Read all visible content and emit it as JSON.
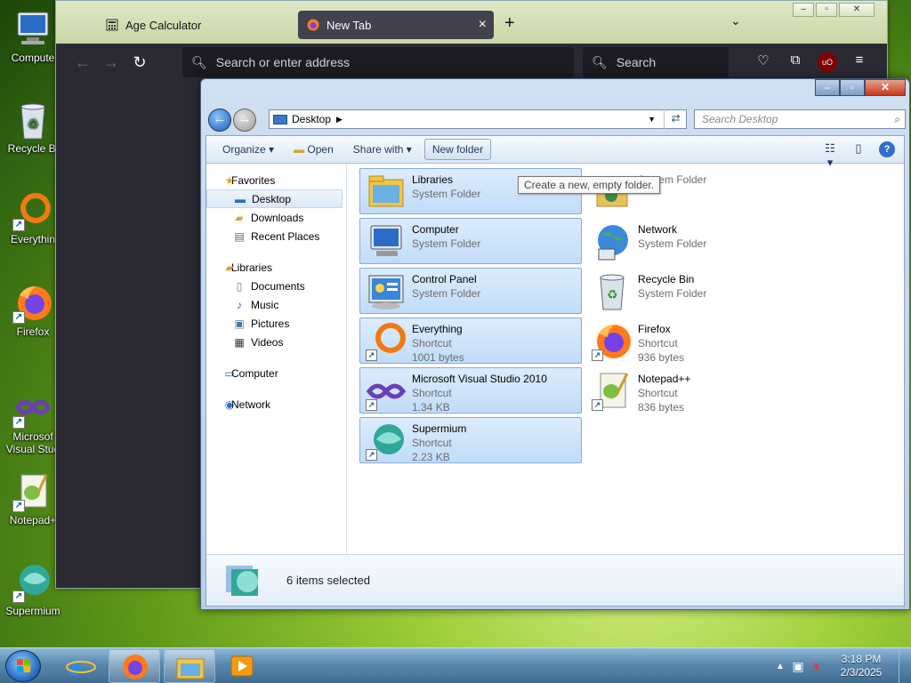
{
  "desktop": {
    "icons": [
      {
        "label": "Compute",
        "icon": "computer-icon"
      },
      {
        "label": "Recycle Bi",
        "icon": "recycle-bin-icon"
      },
      {
        "label": "Everythin",
        "icon": "everything-icon"
      },
      {
        "label": "Firefox",
        "icon": "firefox-icon"
      },
      {
        "label": "Microsof Visual Stud",
        "icon": "visual-studio-icon"
      },
      {
        "label": "Notepad+",
        "icon": "notepad-plus-plus-icon"
      },
      {
        "label": "Supermium",
        "icon": "supermium-icon"
      }
    ]
  },
  "firefox": {
    "tabs": [
      {
        "label": "Age Calculator",
        "icon": "calculator-icon"
      },
      {
        "label": "New Tab",
        "icon": "firefox-icon"
      }
    ],
    "address_placeholder": "Search or enter address",
    "search_placeholder": "Search",
    "ublock_label": "uO"
  },
  "explorer": {
    "address": "Desktop",
    "search_placeholder": "Search Desktop",
    "commands": {
      "organize": "Organize",
      "open": "Open",
      "share_with": "Share with",
      "new_folder": "New folder"
    },
    "tooltip": "Create a new, empty folder.",
    "nav": {
      "favorites": "Favorites",
      "desktop": "Desktop",
      "downloads": "Downloads",
      "recent_places": "Recent Places",
      "libraries": "Libraries",
      "documents": "Documents",
      "music": "Music",
      "pictures": "Pictures",
      "videos": "Videos",
      "computer": "Computer",
      "network": "Network"
    },
    "items": [
      {
        "name": "Libraries",
        "type": "System Folder",
        "size": "",
        "selected": true
      },
      {
        "name": "",
        "type": "System Folder",
        "size": "",
        "selected": false
      },
      {
        "name": "Computer",
        "type": "System Folder",
        "size": "",
        "selected": true
      },
      {
        "name": "Network",
        "type": "System Folder",
        "size": "",
        "selected": false
      },
      {
        "name": "Control Panel",
        "type": "System Folder",
        "size": "",
        "selected": true
      },
      {
        "name": "Recycle Bin",
        "type": "System Folder",
        "size": "",
        "selected": false
      },
      {
        "name": "Everything",
        "type": "Shortcut",
        "size": "1001 bytes",
        "selected": true
      },
      {
        "name": "Firefox",
        "type": "Shortcut",
        "size": "936 bytes",
        "selected": false
      },
      {
        "name": "Microsoft Visual Studio 2010",
        "type": "Shortcut",
        "size": "1.34 KB",
        "selected": true
      },
      {
        "name": "Notepad++",
        "type": "Shortcut",
        "size": "836 bytes",
        "selected": false
      },
      {
        "name": "Supermium",
        "type": "Shortcut",
        "size": "2.23 KB",
        "selected": true
      }
    ],
    "status": "6 items selected"
  },
  "taskbar": {
    "time": "3:18 PM",
    "date": "2/3/2025"
  }
}
